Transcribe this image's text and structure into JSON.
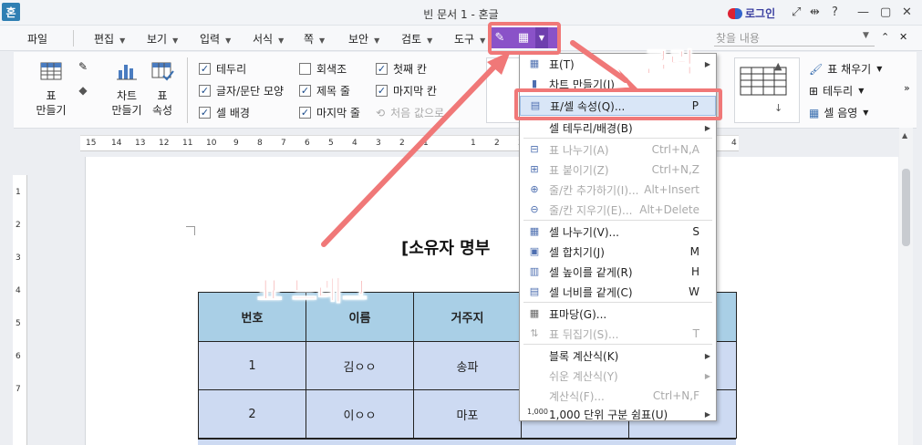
{
  "window": {
    "icon": "혼",
    "title": "빈 문서 1 - 혼글",
    "login": "로그인",
    "help": "?"
  },
  "menu": {
    "items": [
      "파일",
      "편집",
      "보기",
      "입력",
      "서식",
      "쪽",
      "보안",
      "검토",
      "도구"
    ],
    "search_placeholder": "찾을 내용"
  },
  "ribbon": {
    "make_table": "표\n만들기",
    "make_chart": "차트\n만들기",
    "table_props": "표\n속성",
    "checks": [
      {
        "label": "테두리",
        "checked": true
      },
      {
        "label": "회색조",
        "checked": false
      },
      {
        "label": "첫째 칸",
        "checked": true
      },
      {
        "label": "글자/문단 모양",
        "checked": true
      },
      {
        "label": "제목 줄",
        "checked": true
      },
      {
        "label": "마지막 칸",
        "checked": true
      },
      {
        "label": "셀 배경",
        "checked": true
      },
      {
        "label": "마지막 줄",
        "checked": true
      },
      {
        "label": "처음 값으로",
        "disabled": true
      }
    ],
    "fill": "표 채우기",
    "border": "테두리",
    "shade": "셀 음영"
  },
  "ruler_ticks": [
    "15",
    "14",
    "13",
    "12",
    "11",
    "10",
    "9",
    "8",
    "7",
    "6",
    "5",
    "4",
    "3",
    "2",
    "1",
    "",
    "1",
    "2",
    "3",
    "4"
  ],
  "vruler_ticks": [
    "1",
    "2",
    "3",
    "4",
    "5",
    "6",
    "7"
  ],
  "document": {
    "title": "[소유자 명부",
    "table": {
      "headers": [
        "번호",
        "이름",
        "거주지",
        "",
        ""
      ],
      "rows": [
        [
          "1",
          "김ㅇㅇ",
          "송파",
          "",
          ""
        ],
        [
          "2",
          "이ㅇㅇ",
          "마포",
          "",
          ""
        ]
      ]
    }
  },
  "context_menu": {
    "items": [
      {
        "label": "표(T)",
        "shortcut": "",
        "sub": true,
        "icon": "table-icon"
      },
      {
        "label": "차트 만들기(I)",
        "shortcut": "",
        "icon": "chart-icon"
      },
      {
        "label": "표/셀 속성(Q)...",
        "shortcut": "P",
        "icon": "table-props-icon",
        "highlight": true
      },
      {
        "label": "셀 테두리/배경(B)",
        "shortcut": "",
        "sub": true
      },
      {
        "label": "표 나누기(A)",
        "shortcut": "Ctrl+N,A",
        "disabled": true,
        "icon": "split-table-icon"
      },
      {
        "label": "표 붙이기(Z)",
        "shortcut": "Ctrl+N,Z",
        "disabled": true,
        "icon": "join-table-icon"
      },
      {
        "label": "줄/칸 추가하기(I)...",
        "shortcut": "Alt+Insert",
        "disabled": true,
        "icon": "insert-row-icon"
      },
      {
        "label": "줄/칸 지우기(E)...",
        "shortcut": "Alt+Delete",
        "disabled": true,
        "icon": "delete-row-icon"
      },
      {
        "label": "셀 나누기(V)...",
        "shortcut": "S",
        "icon": "split-cell-icon"
      },
      {
        "label": "셀 합치기(J)",
        "shortcut": "M",
        "icon": "merge-cell-icon"
      },
      {
        "label": "셀 높이를 같게(R)",
        "shortcut": "H",
        "icon": "equal-height-icon"
      },
      {
        "label": "셀 너비를 같게(C)",
        "shortcut": "W",
        "icon": "equal-width-icon"
      },
      {
        "label": "표마당(G)...",
        "shortcut": "",
        "icon": "table-gallery-icon"
      },
      {
        "label": "표 뒤집기(S)...",
        "shortcut": "T",
        "disabled": true,
        "icon": "flip-table-icon"
      },
      {
        "label": "블록 계산식(K)",
        "shortcut": "",
        "sub": true
      },
      {
        "label": "쉬운 계산식(Y)",
        "shortcut": "",
        "sub": true,
        "disabled": true
      },
      {
        "label": "계산식(F)...",
        "shortcut": "Ctrl+N,F",
        "disabled": true
      },
      {
        "label": "1,000 단위 구분 쉼표(U)",
        "shortcut": "",
        "sub": true,
        "icon": "thousands-comma-icon"
      }
    ]
  },
  "annotations": {
    "click": "클릭",
    "drag": "표 드래그",
    "color": "#f07878"
  }
}
